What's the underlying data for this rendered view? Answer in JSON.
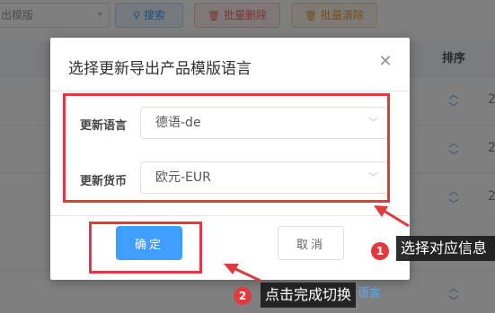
{
  "background": {
    "select_value": "出模版",
    "search_label": "搜索",
    "batch_delete_label": "批量删除",
    "batch_clear_label": "批量清除",
    "sort_header": "排序",
    "row_digit": "2",
    "partial_link": "语言"
  },
  "dialog": {
    "title": "选择更新导出产品模版语言",
    "language_label": "更新语言",
    "language_value": "德语-de",
    "currency_label": "更新货币",
    "currency_value": "欧元-EUR",
    "confirm_label": "确定",
    "cancel_label": "取消"
  },
  "annotations": {
    "step1_number": "1",
    "step1_text": "选择对应信息",
    "step2_number": "2",
    "step2_text": "点击完成切换",
    "color": "#e0393e"
  },
  "colors": {
    "primary": "#409eff",
    "danger": "#f56c6c",
    "warning": "#e6a23c"
  }
}
